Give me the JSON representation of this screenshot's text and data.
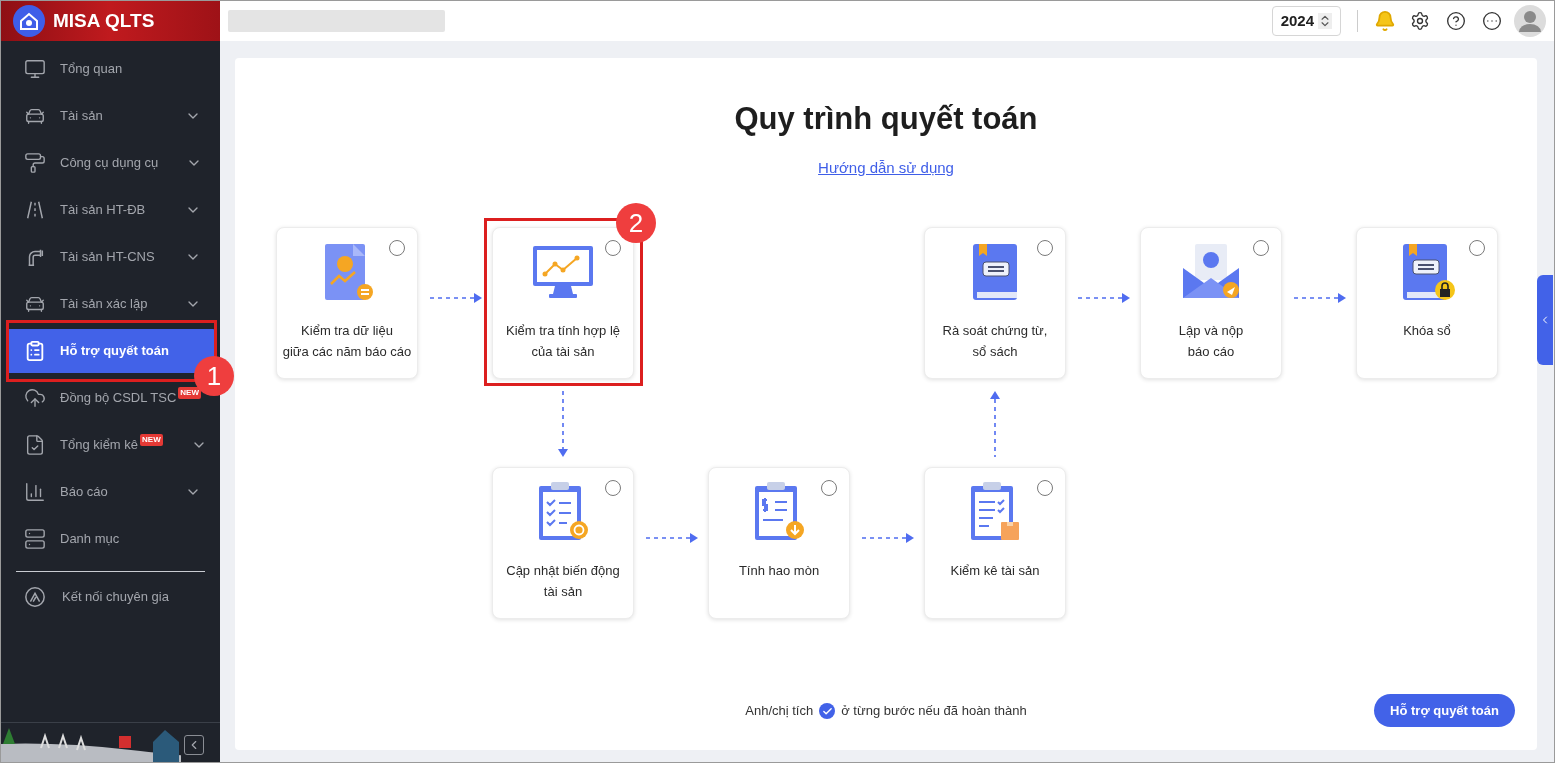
{
  "app": {
    "title": "MISA QLTS"
  },
  "header": {
    "year": "2024"
  },
  "sidebar": {
    "items": [
      {
        "label": "Tổng quan",
        "expandable": false,
        "selected": false
      },
      {
        "label": "Tài sản",
        "expandable": true,
        "selected": false
      },
      {
        "label": "Công cụ dụng cụ",
        "expandable": true,
        "selected": false
      },
      {
        "label": "Tài sản HT-ĐB",
        "expandable": true,
        "selected": false
      },
      {
        "label": "Tài sản HT-CNS",
        "expandable": true,
        "selected": false
      },
      {
        "label": "Tài sản xác lập",
        "expandable": true,
        "selected": false
      },
      {
        "label": "Hỗ trợ quyết toán",
        "expandable": false,
        "selected": true,
        "annotation": "1"
      },
      {
        "label": "Đồng bộ CSDL TSC",
        "expandable": false,
        "selected": false,
        "badge": "NEW"
      },
      {
        "label": "Tổng kiểm kê",
        "expandable": true,
        "selected": false,
        "badge": "NEW"
      },
      {
        "label": "Báo cáo",
        "expandable": true,
        "selected": false
      },
      {
        "label": "Danh mục",
        "expandable": false,
        "selected": false
      }
    ],
    "footer_item": {
      "label": "Kết nối chuyên gia"
    }
  },
  "page": {
    "title": "Quy trình quyết toán",
    "help_link": "Hướng dẫn sử dụng",
    "steps": [
      {
        "label": "Kiểm tra dữ liệu\ngiữa các năm báo cáo",
        "done": false
      },
      {
        "label": "Kiểm tra tính hợp lệ\ncủa tài sản",
        "done": false,
        "annotation": "2"
      },
      {
        "label": "Cập nhật biến động\ntài sản",
        "done": false
      },
      {
        "label": "Tính hao mòn",
        "done": false
      },
      {
        "label": "Kiểm kê tài sản",
        "done": false
      },
      {
        "label": "Rà soát chứng từ,\nsổ sách",
        "done": false
      },
      {
        "label": "Lập và nộp\nbáo cáo",
        "done": false
      },
      {
        "label": "Khóa sổ",
        "done": false
      }
    ],
    "hint_before": "Anh/chị tích",
    "hint_after": "ở từng bước nếu đã hoàn thành",
    "button": "Hỗ trợ quyết toán"
  }
}
